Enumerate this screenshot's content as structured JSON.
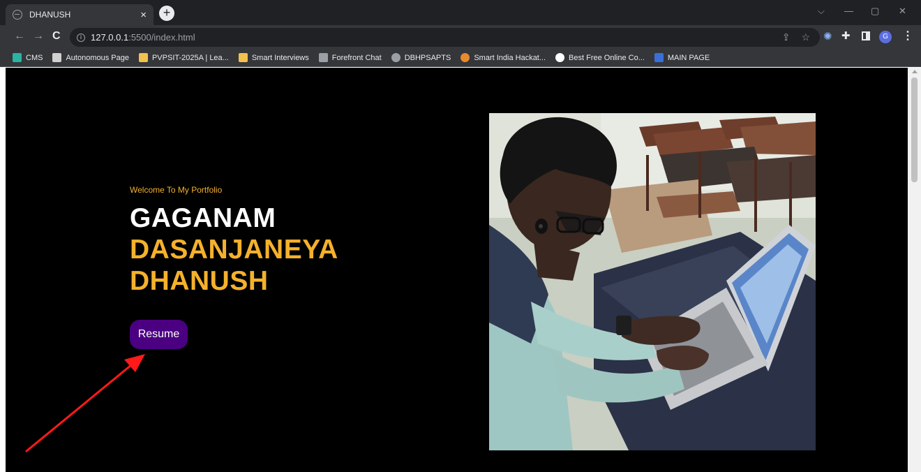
{
  "tab": {
    "title": "DHANUSH",
    "close": "×",
    "new_tab": "+"
  },
  "window_controls": {
    "dropdown": "⌵",
    "minimize": "—",
    "restore": "▢",
    "close": "✕"
  },
  "toolbar": {
    "back": "←",
    "forward": "→",
    "reload": "C",
    "url_host": "127.0.0.1",
    "url_path": ":5500/index.html",
    "share": "⇪",
    "star": "☆",
    "avatar_letter": "G",
    "menu": "⋮"
  },
  "bookmarks": [
    {
      "label": "CMS",
      "icon": "cms-bird-icon",
      "color": "#2bb3a3"
    },
    {
      "label": "Autonomous Page",
      "icon": "svit-logo-icon",
      "color": "#d0d0d0"
    },
    {
      "label": "PVPSIT-2025A | Lea...",
      "icon": "image-icon",
      "color": "#f2c14e"
    },
    {
      "label": "Smart Interviews",
      "icon": "image-icon",
      "color": "#f2c14e"
    },
    {
      "label": "Forefront Chat",
      "icon": "forefront-icon",
      "color": "#9aa0a6"
    },
    {
      "label": "DBHPSAPTS",
      "icon": "globe-icon",
      "color": "#9aa0a6"
    },
    {
      "label": "Smart India Hackat...",
      "icon": "bulb-icon",
      "color": "#e88a2e"
    },
    {
      "label": "Best Free Online Co...",
      "icon": "google-icon",
      "color": "#ffffff"
    },
    {
      "label": "MAIN PAGE",
      "icon": "calendar-icon",
      "color": "#3b6fd8"
    }
  ],
  "hero": {
    "welcome": "Welcome To My Portfolio",
    "name_line1": "GAGANAM",
    "name_line2": "DASANJANEYA",
    "name_line3": "DHANUSH",
    "resume_button": "Resume"
  },
  "colors": {
    "accent_gold": "#f5b12c",
    "button_purple": "#4b0082",
    "annotation_arrow": "#ff1a1a"
  }
}
